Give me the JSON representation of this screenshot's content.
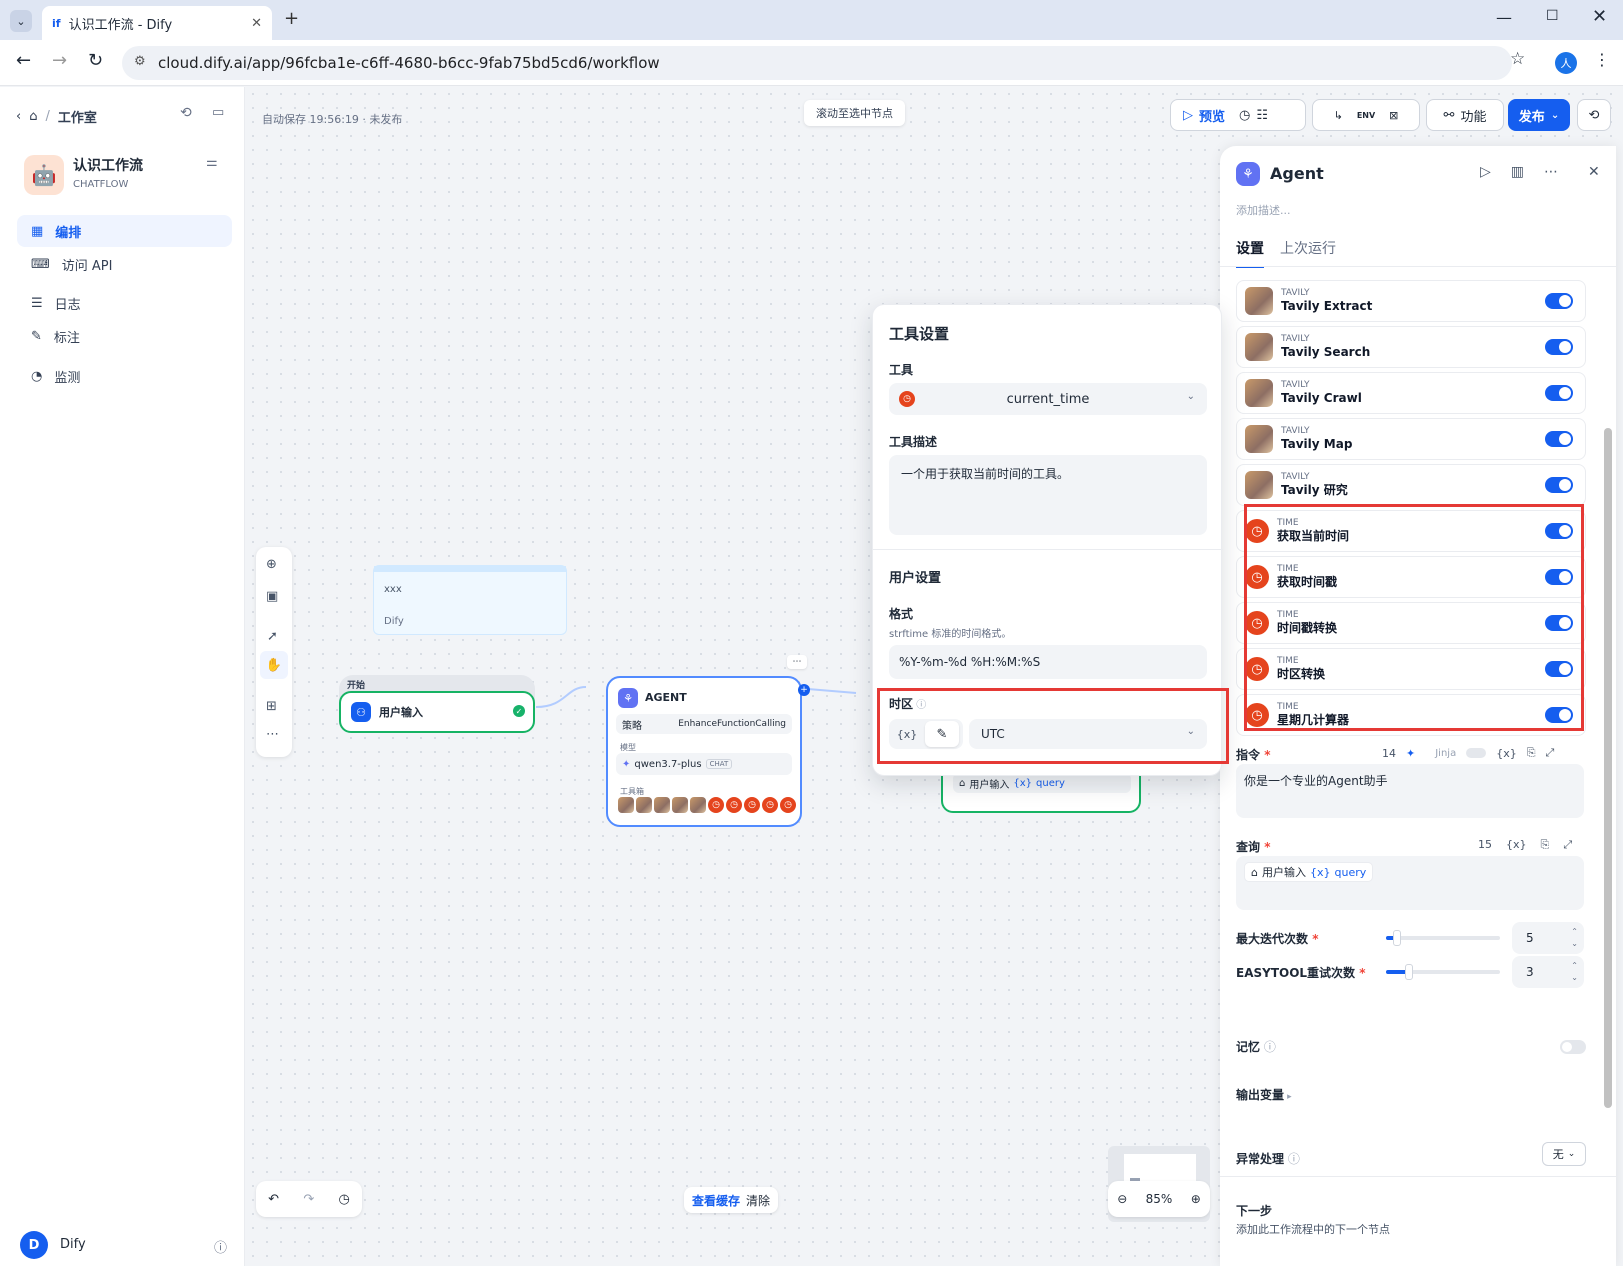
{
  "browser": {
    "tab_title": "认识工作流 - Dify",
    "url": "cloud.dify.ai/app/96fcba1e-c6ff-4680-b6cc-9fab75bd5cd6/workflow",
    "avatar": "人"
  },
  "sidebar": {
    "breadcrumb": "工作室",
    "app_name": "认识工作流",
    "app_type": "CHATFLOW",
    "nav": [
      "编排",
      "访问 API",
      "日志",
      "标注",
      "监测"
    ],
    "user_initial": "D",
    "user_name": "Dify"
  },
  "topbar": {
    "autosave": "自动保存 19:56:19 · 未发布",
    "scroll_to_node": "滚动至选中节点",
    "preview": "预览",
    "features": "功能",
    "publish": "发布",
    "env": "ENV"
  },
  "canvas": {
    "note": {
      "text": "xxx",
      "author": "Dify"
    },
    "start_node": {
      "label": "开始",
      "title": "用户输入"
    },
    "agent_node": {
      "title": "AGENT",
      "strategy_label": "策略",
      "strategy": "EnhanceFunctionCalling",
      "model_label": "模型",
      "model": "qwen3.7-plus",
      "model_badge": "CHAT",
      "tools_label": "工具箱"
    },
    "hidden_node_var": {
      "source": "用户输入",
      "var": "query"
    },
    "view_cache": "查看缓存",
    "clear": "清除",
    "zoom": "85%"
  },
  "popover": {
    "title": "工具设置",
    "tool_label": "工具",
    "tool_value": "current_time",
    "desc_label": "工具描述",
    "desc": "一个用于获取当前时间的工具。",
    "user_settings": "用户设置",
    "format_label": "格式",
    "format_hint": "strftime 标准的时间格式。",
    "format_value": "%Y-%m-%d %H:%M:%S",
    "tz_label": "时区",
    "tz_value": "UTC",
    "var_icon": "{x}"
  },
  "panel": {
    "title": "Agent",
    "desc_placeholder": "添加描述...",
    "tabs": [
      "设置",
      "上次运行"
    ],
    "tools": [
      {
        "provider": "TAVILY",
        "name": "Tavily Extract",
        "kind": "tavily"
      },
      {
        "provider": "TAVILY",
        "name": "Tavily Search",
        "kind": "tavily"
      },
      {
        "provider": "TAVILY",
        "name": "Tavily Crawl",
        "kind": "tavily"
      },
      {
        "provider": "TAVILY",
        "name": "Tavily Map",
        "kind": "tavily"
      },
      {
        "provider": "TAVILY",
        "name": "Tavily 研究",
        "kind": "tavily"
      },
      {
        "provider": "TIME",
        "name": "获取当前时间",
        "kind": "time"
      },
      {
        "provider": "TIME",
        "name": "获取时间戳",
        "kind": "time"
      },
      {
        "provider": "TIME",
        "name": "时间戳转换",
        "kind": "time"
      },
      {
        "provider": "TIME",
        "name": "时区转换",
        "kind": "time"
      },
      {
        "provider": "TIME",
        "name": "星期几计算器",
        "kind": "time"
      }
    ],
    "instruction": {
      "label": "指令",
      "count": "14",
      "jinja": "Jinja",
      "value": "你是一个专业的Agent助手"
    },
    "query": {
      "label": "查询",
      "count": "15",
      "source": "用户输入",
      "var": "query"
    },
    "max_iter": {
      "label": "最大迭代次数",
      "value": "5",
      "fraction": 0.1
    },
    "retry": {
      "label": "EASYTOOL重试次数",
      "value": "3",
      "fraction": 0.2
    },
    "memory": "记忆",
    "output_vars": "输出变量",
    "error_handling": "异常处理",
    "error_value": "无",
    "next_step": "下一步",
    "next_step_desc": "添加此工作流程中的下一个节点"
  }
}
